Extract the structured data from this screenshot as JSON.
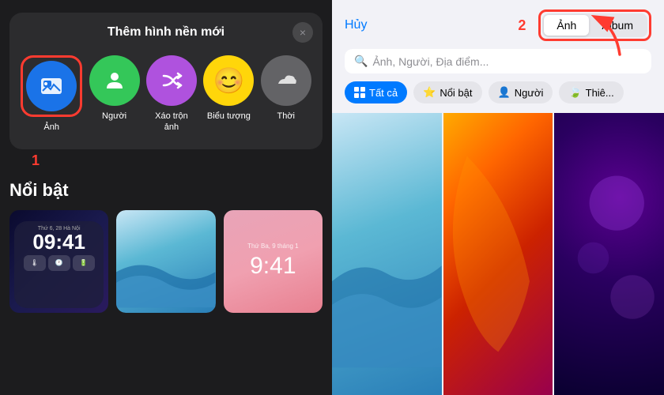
{
  "left": {
    "modal": {
      "title": "Thêm hình nền mới",
      "close_icon": "×",
      "icons": [
        {
          "id": "anh",
          "label": "Ảnh",
          "color": "blue",
          "emoji": "🖼",
          "selected": true
        },
        {
          "id": "nguoi",
          "label": "Người",
          "color": "green",
          "emoji": "👤"
        },
        {
          "id": "xao_tron",
          "label": "Xáo trộn\nảnh",
          "color": "purple",
          "emoji": "🔀"
        },
        {
          "id": "bieu_tuong",
          "label": "Biểu tượng",
          "color": "yellow",
          "emoji": "😊"
        },
        {
          "id": "tho",
          "label": "Thời",
          "color": "gray",
          "emoji": "☁"
        }
      ],
      "step1_label": "1"
    },
    "noibat": {
      "title": "Nổi bật",
      "wallpapers": [
        {
          "type": "dark",
          "time_small": "Thứ 6, 28 Hà Nội",
          "time_big": "09:41"
        },
        {
          "type": "pink",
          "date": "Thứ Ba, 9 tháng 1",
          "time_big": "9:41"
        },
        {
          "type": "blue_wave"
        }
      ]
    }
  },
  "right": {
    "cancel_label": "Hủy",
    "step2_label": "2",
    "tabs": [
      {
        "id": "anh",
        "label": "Ảnh",
        "active": true
      },
      {
        "id": "album",
        "label": "Album",
        "active": false
      }
    ],
    "search_placeholder": "Ảnh, Người, Địa điểm...",
    "search_icon": "🔍",
    "filters": [
      {
        "id": "tat_ca",
        "label": "Tất cả",
        "icon": "grid",
        "active": true
      },
      {
        "id": "noi_bat",
        "label": "Nổi bật",
        "icon": "star",
        "active": false
      },
      {
        "id": "nguoi",
        "label": "Người",
        "icon": "person",
        "active": false
      },
      {
        "id": "thien",
        "label": "Thiên",
        "icon": "leaf",
        "active": false
      }
    ],
    "photos": [
      {
        "type": "blue_wave"
      },
      {
        "type": "orange_red"
      },
      {
        "type": "dark_bokeh"
      }
    ]
  }
}
